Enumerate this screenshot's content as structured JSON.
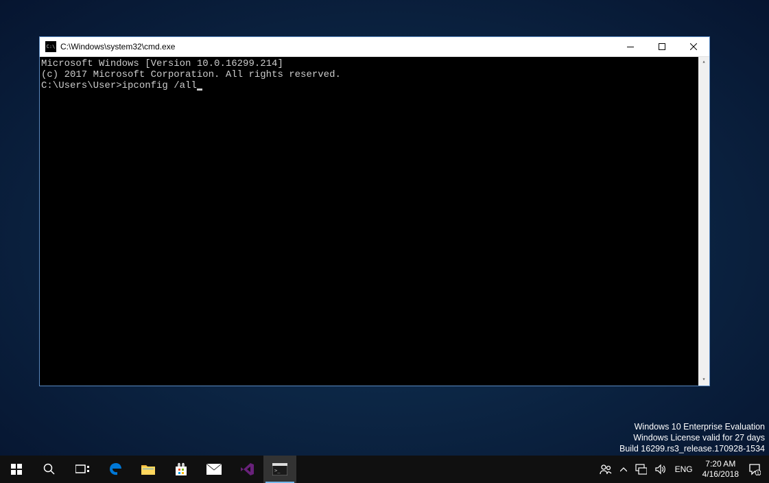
{
  "cmd_window": {
    "title": "C:\\Windows\\system32\\cmd.exe",
    "lines": {
      "l1": "Microsoft Windows [Version 10.0.16299.214]",
      "l2": "(c) 2017 Microsoft Corporation. All rights reserved.",
      "l3": "",
      "prompt": "C:\\Users\\User>",
      "command": "ipconfig /all"
    }
  },
  "watermark": {
    "line1": "Windows 10 Enterprise Evaluation",
    "line2": "Windows License valid for 27 days",
    "line3": "Build 16299.rs3_release.170928-1534"
  },
  "taskbar": {
    "language": "ENG",
    "time": "7:20 AM",
    "date": "4/16/2018"
  }
}
